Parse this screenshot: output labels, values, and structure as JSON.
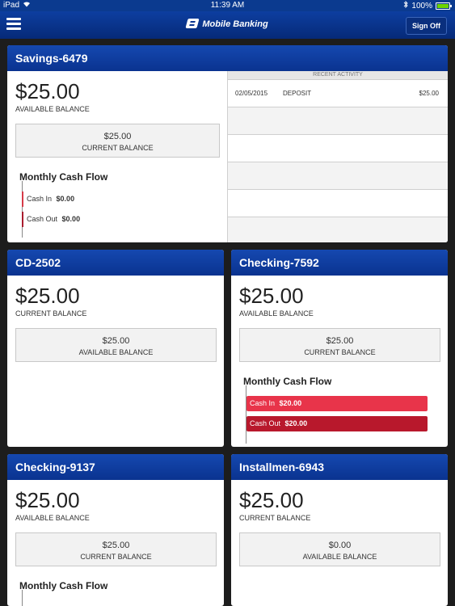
{
  "status": {
    "device": "iPad",
    "time": "11:39 AM",
    "battery": "100%"
  },
  "nav": {
    "brand": "Mobile Banking",
    "sign_off": "Sign Off"
  },
  "cards": {
    "savings": {
      "title": "Savings-6479",
      "primary_value": "$25.00",
      "primary_label": "AVAILABLE BALANCE",
      "secondary_value": "$25.00",
      "secondary_label": "CURRENT BALANCE",
      "cashflow_title": "Monthly Cash Flow",
      "cash_in_label": "Cash In",
      "cash_in_value": "$0.00",
      "cash_out_label": "Cash Out",
      "cash_out_value": "$0.00",
      "recent_title": "RECENT ACTIVITY",
      "recent": [
        {
          "date": "02/05/2015",
          "desc": "DEPOSIT",
          "amount": "$25.00"
        }
      ]
    },
    "cd": {
      "title": "CD-2502",
      "primary_value": "$25.00",
      "primary_label": "CURRENT BALANCE",
      "secondary_value": "$25.00",
      "secondary_label": "AVAILABLE BALANCE"
    },
    "checking7592": {
      "title": "Checking-7592",
      "primary_value": "$25.00",
      "primary_label": "AVAILABLE BALANCE",
      "secondary_value": "$25.00",
      "secondary_label": "CURRENT BALANCE",
      "cashflow_title": "Monthly Cash Flow",
      "cash_in_label": "Cash In",
      "cash_in_value": "$20.00",
      "cash_out_label": "Cash Out",
      "cash_out_value": "$20.00"
    },
    "checking9137": {
      "title": "Checking-9137",
      "primary_value": "$25.00",
      "primary_label": "AVAILABLE BALANCE",
      "secondary_value": "$25.00",
      "secondary_label": "CURRENT BALANCE",
      "cashflow_title": "Monthly Cash Flow"
    },
    "installment": {
      "title": "Installmen-6943",
      "primary_value": "$25.00",
      "primary_label": "CURRENT BALANCE",
      "secondary_value": "$0.00",
      "secondary_label": "AVAILABLE BALANCE"
    }
  },
  "colors": {
    "header_blue": "#0a3390",
    "cash_in": "#e8344a",
    "cash_out": "#b8182c"
  }
}
